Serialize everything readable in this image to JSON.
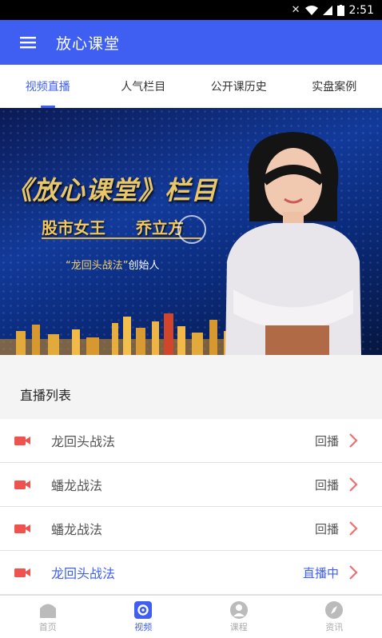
{
  "statusbar": {
    "time": "2:51"
  },
  "appbar": {
    "title": "放心课堂"
  },
  "tabs": [
    {
      "label": "视频直播",
      "active": true
    },
    {
      "label": "人气栏目",
      "active": false
    },
    {
      "label": "公开课历史",
      "active": false
    },
    {
      "label": "实盘案例",
      "active": false
    }
  ],
  "banner": {
    "title": "《放心课堂》栏目",
    "subtitle_left": "股市女王",
    "subtitle_right": "乔立方",
    "caption_quote": "“龙回头战法”",
    "caption_rest": "创始人"
  },
  "live_list": {
    "heading": "直播列表",
    "items": [
      {
        "name": "龙回头战法",
        "status": "回播",
        "live": false
      },
      {
        "name": "蟠龙战法",
        "status": "回播",
        "live": false
      },
      {
        "name": "蟠龙战法",
        "status": "回播",
        "live": false
      },
      {
        "name": "龙回头战法",
        "status": "直播中",
        "live": true
      }
    ]
  },
  "bottom_nav": [
    {
      "label": "首页",
      "icon": "home-icon",
      "active": false
    },
    {
      "label": "视频",
      "icon": "video-icon",
      "active": true
    },
    {
      "label": "课程",
      "icon": "course-icon",
      "active": false
    },
    {
      "label": "资讯",
      "icon": "compass-icon",
      "active": false
    }
  ],
  "colors": {
    "accent": "#3f5ff2",
    "camera": "#ef5350",
    "chevron": "#ef7070"
  }
}
